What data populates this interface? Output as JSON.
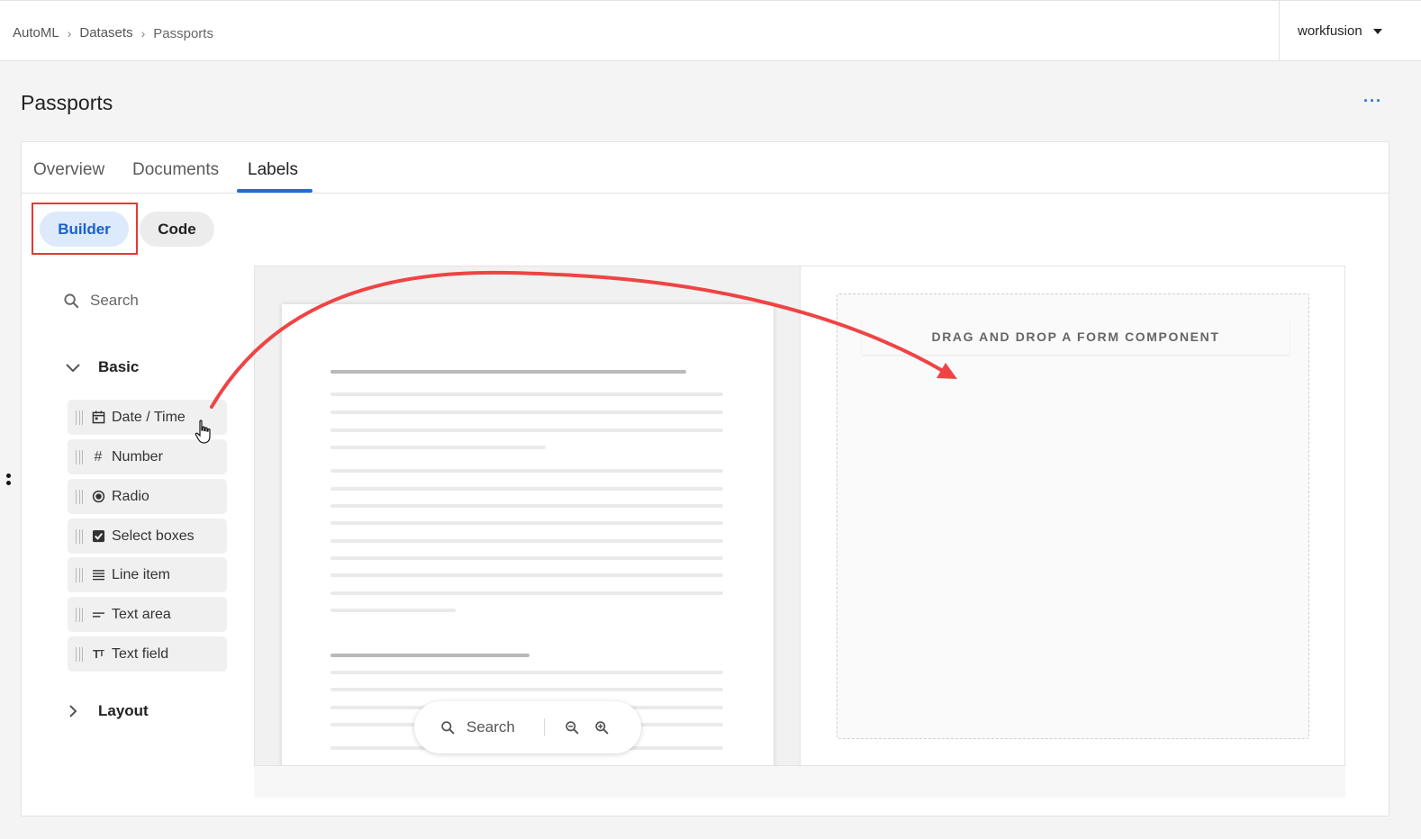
{
  "breadcrumb": {
    "items": [
      "AutoML",
      "Datasets",
      "Passports"
    ]
  },
  "account": {
    "name": "workfusion"
  },
  "page": {
    "title": "Passports",
    "more_label": "···"
  },
  "tabs": [
    "Overview",
    "Documents",
    "Labels"
  ],
  "active_tab": "Labels",
  "mode_toggle": {
    "builder_label": "Builder",
    "code_label": "Code",
    "selected": "Builder"
  },
  "palette": {
    "search_placeholder": "Search",
    "groups": [
      {
        "label": "Basic",
        "expanded": true,
        "items": [
          {
            "label": "Date / Time",
            "icon": "calendar-icon"
          },
          {
            "label": "Number",
            "icon": "hash-icon"
          },
          {
            "label": "Radio",
            "icon": "radio-icon"
          },
          {
            "label": "Select boxes",
            "icon": "checkbox-icon"
          },
          {
            "label": "Line item",
            "icon": "list-lines-icon"
          },
          {
            "label": "Text area",
            "icon": "text-area-icon"
          },
          {
            "label": "Text field",
            "icon": "text-field-icon"
          }
        ]
      },
      {
        "label": "Layout",
        "expanded": false
      }
    ]
  },
  "document_viewer": {
    "search_label": "Search",
    "zoom_out_icon": "zoom-out-icon",
    "zoom_in_icon": "zoom-in-icon"
  },
  "form_builder": {
    "dropzone_label": "DRAG AND DROP A FORM COMPONENT"
  },
  "colors": {
    "accent": "#1a6ed8",
    "annotation": "#e53935",
    "builder_bg": "#ddeafc"
  }
}
